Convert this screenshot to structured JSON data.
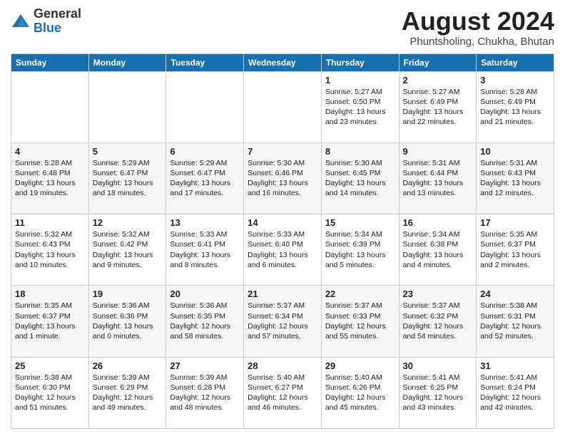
{
  "header": {
    "logo_line1": "General",
    "logo_line2": "Blue",
    "main_title": "August 2024",
    "subtitle": "Phuntsholing, Chukha, Bhutan"
  },
  "days_of_week": [
    "Sunday",
    "Monday",
    "Tuesday",
    "Wednesday",
    "Thursday",
    "Friday",
    "Saturday"
  ],
  "weeks": [
    [
      {
        "day": "",
        "content": ""
      },
      {
        "day": "",
        "content": ""
      },
      {
        "day": "",
        "content": ""
      },
      {
        "day": "",
        "content": ""
      },
      {
        "day": "1",
        "content": "Sunrise: 5:27 AM\nSunset: 6:50 PM\nDaylight: 13 hours\nand 23 minutes."
      },
      {
        "day": "2",
        "content": "Sunrise: 5:27 AM\nSunset: 6:49 PM\nDaylight: 13 hours\nand 22 minutes."
      },
      {
        "day": "3",
        "content": "Sunrise: 5:28 AM\nSunset: 6:49 PM\nDaylight: 13 hours\nand 21 minutes."
      }
    ],
    [
      {
        "day": "4",
        "content": "Sunrise: 5:28 AM\nSunset: 6:48 PM\nDaylight: 13 hours\nand 19 minutes."
      },
      {
        "day": "5",
        "content": "Sunrise: 5:29 AM\nSunset: 6:47 PM\nDaylight: 13 hours\nand 18 minutes."
      },
      {
        "day": "6",
        "content": "Sunrise: 5:29 AM\nSunset: 6:47 PM\nDaylight: 13 hours\nand 17 minutes."
      },
      {
        "day": "7",
        "content": "Sunrise: 5:30 AM\nSunset: 6:46 PM\nDaylight: 13 hours\nand 16 minutes."
      },
      {
        "day": "8",
        "content": "Sunrise: 5:30 AM\nSunset: 6:45 PM\nDaylight: 13 hours\nand 14 minutes."
      },
      {
        "day": "9",
        "content": "Sunrise: 5:31 AM\nSunset: 6:44 PM\nDaylight: 13 hours\nand 13 minutes."
      },
      {
        "day": "10",
        "content": "Sunrise: 5:31 AM\nSunset: 6:43 PM\nDaylight: 13 hours\nand 12 minutes."
      }
    ],
    [
      {
        "day": "11",
        "content": "Sunrise: 5:32 AM\nSunset: 6:43 PM\nDaylight: 13 hours\nand 10 minutes."
      },
      {
        "day": "12",
        "content": "Sunrise: 5:32 AM\nSunset: 6:42 PM\nDaylight: 13 hours\nand 9 minutes."
      },
      {
        "day": "13",
        "content": "Sunrise: 5:33 AM\nSunset: 6:41 PM\nDaylight: 13 hours\nand 8 minutes."
      },
      {
        "day": "14",
        "content": "Sunrise: 5:33 AM\nSunset: 6:40 PM\nDaylight: 13 hours\nand 6 minutes."
      },
      {
        "day": "15",
        "content": "Sunrise: 5:34 AM\nSunset: 6:39 PM\nDaylight: 13 hours\nand 5 minutes."
      },
      {
        "day": "16",
        "content": "Sunrise: 5:34 AM\nSunset: 6:38 PM\nDaylight: 13 hours\nand 4 minutes."
      },
      {
        "day": "17",
        "content": "Sunrise: 5:35 AM\nSunset: 6:37 PM\nDaylight: 13 hours\nand 2 minutes."
      }
    ],
    [
      {
        "day": "18",
        "content": "Sunrise: 5:35 AM\nSunset: 6:37 PM\nDaylight: 13 hours\nand 1 minute."
      },
      {
        "day": "19",
        "content": "Sunrise: 5:36 AM\nSunset: 6:36 PM\nDaylight: 13 hours\nand 0 minutes."
      },
      {
        "day": "20",
        "content": "Sunrise: 5:36 AM\nSunset: 6:35 PM\nDaylight: 12 hours\nand 58 minutes."
      },
      {
        "day": "21",
        "content": "Sunrise: 5:37 AM\nSunset: 6:34 PM\nDaylight: 12 hours\nand 57 minutes."
      },
      {
        "day": "22",
        "content": "Sunrise: 5:37 AM\nSunset: 6:33 PM\nDaylight: 12 hours\nand 55 minutes."
      },
      {
        "day": "23",
        "content": "Sunrise: 5:37 AM\nSunset: 6:32 PM\nDaylight: 12 hours\nand 54 minutes."
      },
      {
        "day": "24",
        "content": "Sunrise: 5:38 AM\nSunset: 6:31 PM\nDaylight: 12 hours\nand 52 minutes."
      }
    ],
    [
      {
        "day": "25",
        "content": "Sunrise: 5:38 AM\nSunset: 6:30 PM\nDaylight: 12 hours\nand 51 minutes."
      },
      {
        "day": "26",
        "content": "Sunrise: 5:39 AM\nSunset: 6:29 PM\nDaylight: 12 hours\nand 49 minutes."
      },
      {
        "day": "27",
        "content": "Sunrise: 5:39 AM\nSunset: 6:28 PM\nDaylight: 12 hours\nand 48 minutes."
      },
      {
        "day": "28",
        "content": "Sunrise: 5:40 AM\nSunset: 6:27 PM\nDaylight: 12 hours\nand 46 minutes."
      },
      {
        "day": "29",
        "content": "Sunrise: 5:40 AM\nSunset: 6:26 PM\nDaylight: 12 hours\nand 45 minutes."
      },
      {
        "day": "30",
        "content": "Sunrise: 5:41 AM\nSunset: 6:25 PM\nDaylight: 12 hours\nand 43 minutes."
      },
      {
        "day": "31",
        "content": "Sunrise: 5:41 AM\nSunset: 6:24 PM\nDaylight: 12 hours\nand 42 minutes."
      }
    ]
  ]
}
